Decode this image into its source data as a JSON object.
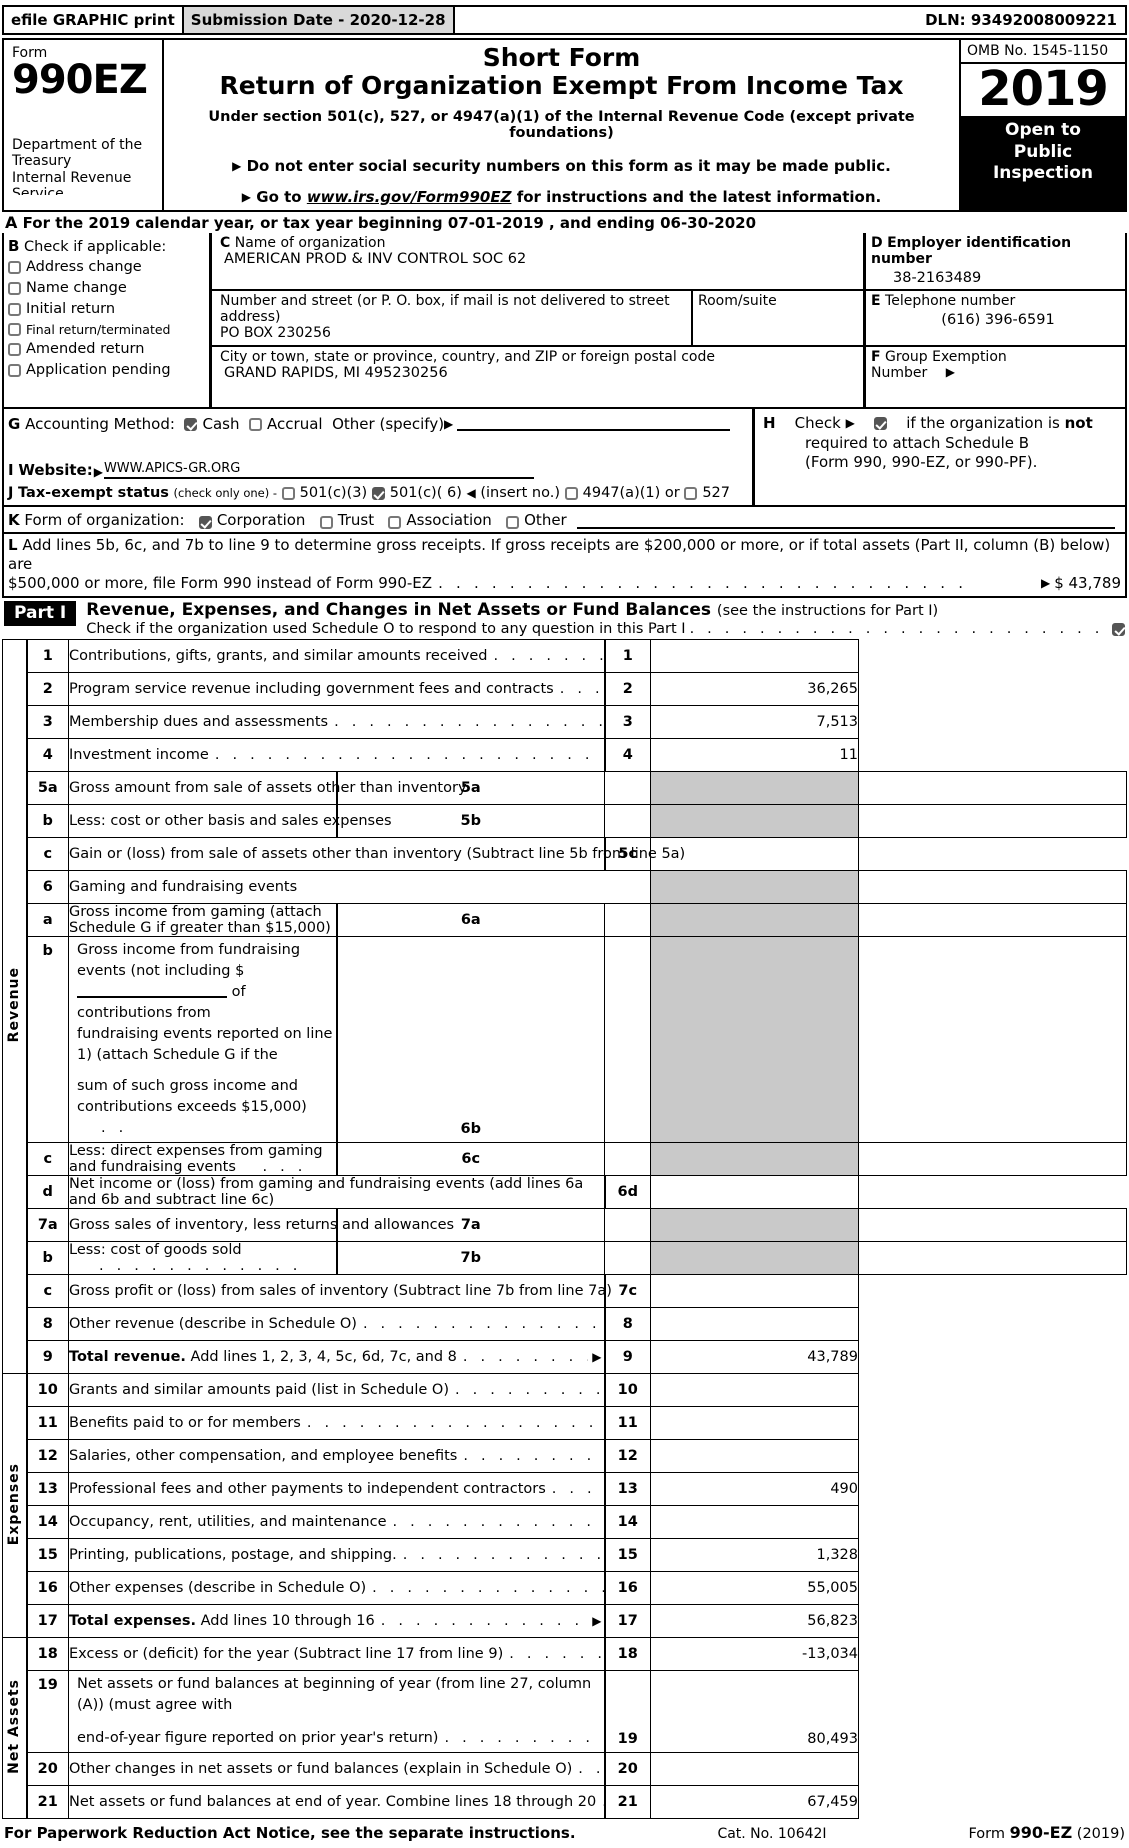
{
  "efile": {
    "graphic_label": "efile GRAPHIC print",
    "submission_label": "Submission Date - 2020-12-28",
    "dln": "DLN: 93492008009221"
  },
  "masthead": {
    "form_label": "Form",
    "form_number": "990EZ",
    "department_line1": "Department of the",
    "department_line2": "Treasury",
    "department_line3": "Internal Revenue",
    "department_line4": "Service",
    "title_line1": "Short Form",
    "title_line2": "Return of Organization Exempt From Income Tax",
    "subtitle": "Under section 501(c), 527, or 4947(a)(1) of the Internal Revenue Code (except private foundations)",
    "bullet1": "Do not enter social security numbers on this form as it may be made public.",
    "bullet2_prefix": "Go to",
    "bullet2_link": "www.irs.gov/Form990EZ",
    "bullet2_suffix": "for instructions and the latest information.",
    "omb": "OMB No. 1545-1150",
    "year": "2019",
    "open_line1": "Open to",
    "open_line2": "Public",
    "open_line3": "Inspection"
  },
  "line_a": {
    "letter": "A",
    "text_before": "For the 2019 calendar year, or tax year beginning",
    "begin_date": "07-01-2019",
    "text_middle": ", and ending",
    "end_date": "06-30-2020"
  },
  "section_b": {
    "letter": "B",
    "heading": "Check if applicable:",
    "items": [
      {
        "label": "Address change",
        "checked": false
      },
      {
        "label": "Name change",
        "checked": false
      },
      {
        "label": "Initial return",
        "checked": false
      },
      {
        "label": "Final return/terminated",
        "checked": false
      },
      {
        "label": "Amended return",
        "checked": false
      },
      {
        "label": "Application pending",
        "checked": false
      }
    ]
  },
  "section_c": {
    "letter": "C",
    "name_label": "Name of organization",
    "name_value": "AMERICAN PROD & INV CONTROL SOC 62",
    "street_label": "Number and street (or P. O. box, if mail is not delivered to street address)",
    "street_value": "PO BOX 230256",
    "room_label": "Room/suite",
    "room_value": "",
    "city_label": "City or town, state or province, country, and ZIP or foreign postal code",
    "city_value": "GRAND RAPIDS, MI   495230256"
  },
  "section_d": {
    "letter": "D",
    "label": "Employer identification number",
    "value": "38-2163489"
  },
  "section_e": {
    "letter": "E",
    "label": "Telephone number",
    "value": "(616) 396-6591"
  },
  "section_f": {
    "letter": "F",
    "label_line1": "Group Exemption",
    "label_line2": "Number",
    "value": ""
  },
  "section_g": {
    "letter": "G",
    "label": "Accounting Method:",
    "cash": "Cash",
    "cash_checked": true,
    "accrual": "Accrual",
    "accrual_checked": false,
    "other": "Other (specify)"
  },
  "section_h": {
    "letter": "H",
    "check_label": "Check",
    "checked": true,
    "text_line1_a": "if the organization is",
    "text_line1_b": "not",
    "text_line2": "required to attach Schedule B",
    "text_line3": "(Form 990, 990-EZ, or 990-PF)."
  },
  "section_i": {
    "letter": "I",
    "label": "Website:",
    "value": "WWW.APICS-GR.ORG"
  },
  "section_j": {
    "letter": "J",
    "label": "Tax-exempt status",
    "note": "(check only one) -",
    "opt1": "501(c)(3)",
    "opt1_checked": false,
    "opt2": "501(c)( 6)",
    "opt2_checked": true,
    "insert_note": "(insert no.)",
    "opt3": "4947(a)(1) or",
    "opt3_checked": false,
    "opt4": "527",
    "opt4_checked": false
  },
  "section_k": {
    "letter": "K",
    "label": "Form of organization:",
    "options": [
      {
        "label": "Corporation",
        "checked": true
      },
      {
        "label": "Trust",
        "checked": false
      },
      {
        "label": "Association",
        "checked": false
      },
      {
        "label": "Other",
        "checked": false
      }
    ]
  },
  "section_l": {
    "letter": "L",
    "line1": "Add lines 5b, 6c, and 7b to line 9 to determine gross receipts. If gross receipts are $200,000 or more, or if total assets (Part II, column (B) below) are",
    "line2": "$500,000 or more, file Form 990 instead of Form 990-EZ",
    "amount": "$ 43,789"
  },
  "part1": {
    "tag": "Part I",
    "title": "Revenue, Expenses, and Changes in Net Assets or Fund Balances",
    "title_note": "(see the instructions for Part I)",
    "schedule_o_text": "Check if the organization used Schedule O to respond to any question in this Part I",
    "schedule_o_checked": true,
    "side_label_revenue": "Revenue",
    "side_label_expenses": "Expenses",
    "side_label_net_assets": "Net Assets",
    "rows": [
      {
        "num": "1",
        "desc": "Contributions, gifts, grants, and similar amounts received",
        "lnum": "1",
        "amount": ""
      },
      {
        "num": "2",
        "desc": "Program service revenue including government fees and contracts",
        "lnum": "2",
        "amount": "36,265"
      },
      {
        "num": "3",
        "desc": "Membership dues and assessments",
        "lnum": "3",
        "amount": "7,513"
      },
      {
        "num": "4",
        "desc": "Investment income",
        "lnum": "4",
        "amount": "11"
      },
      {
        "num": "5a",
        "desc": "Gross amount from sale of assets other than inventory",
        "subnum": "5a",
        "subval": ""
      },
      {
        "num": "b",
        "desc": "Less: cost or other basis and sales expenses",
        "subnum": "5b",
        "subval": ""
      },
      {
        "num": "c",
        "desc": "Gain or (loss) from sale of assets other than inventory (Subtract line 5b from line 5a)",
        "lnum": "5c",
        "amount": ""
      },
      {
        "num": "6",
        "desc": "Gaming and fundraising events"
      },
      {
        "num": "a",
        "desc": "Gross income from gaming (attach Schedule G if greater than $15,000)",
        "subnum": "6a",
        "subval": ""
      },
      {
        "num": "b",
        "desc_l1_a": "Gross income from fundraising events (not including $",
        "desc_l1_b": "of contributions from",
        "desc_l2": "fundraising events reported on line 1) (attach Schedule G if the",
        "desc_l3": "sum of such gross income and contributions exceeds $15,000)",
        "subnum": "6b",
        "subval": ""
      },
      {
        "num": "c",
        "desc": "Less: direct expenses from gaming and fundraising events",
        "subnum": "6c",
        "subval": ""
      },
      {
        "num": "d",
        "desc": "Net income or (loss) from gaming and fundraising events (add lines 6a and 6b and subtract line 6c)",
        "lnum": "6d",
        "amount": ""
      },
      {
        "num": "7a",
        "desc": "Gross sales of inventory, less returns and allowances",
        "subnum": "7a",
        "subval": ""
      },
      {
        "num": "b",
        "desc": "Less: cost of goods sold",
        "subnum": "7b",
        "subval": ""
      },
      {
        "num": "c",
        "desc": "Gross profit or (loss) from sales of inventory (Subtract line 7b from line 7a)",
        "lnum": "7c",
        "amount": ""
      },
      {
        "num": "8",
        "desc": "Other revenue (describe in Schedule O)",
        "lnum": "8",
        "amount": ""
      },
      {
        "num": "9",
        "desc_bold": "Total revenue.",
        "desc": "Add lines 1, 2, 3, 4, 5c, 6d, 7c, and 8",
        "lnum": "9",
        "amount": "43,789"
      },
      {
        "num": "10",
        "desc": "Grants and similar amounts paid (list in Schedule O)",
        "lnum": "10",
        "amount": ""
      },
      {
        "num": "11",
        "desc": "Benefits paid to or for members",
        "lnum": "11",
        "amount": ""
      },
      {
        "num": "12",
        "desc": "Salaries, other compensation, and employee benefits",
        "lnum": "12",
        "amount": ""
      },
      {
        "num": "13",
        "desc": "Professional fees and other payments to independent contractors",
        "lnum": "13",
        "amount": "490"
      },
      {
        "num": "14",
        "desc": "Occupancy, rent, utilities, and maintenance",
        "lnum": "14",
        "amount": ""
      },
      {
        "num": "15",
        "desc": "Printing, publications, postage, and shipping.",
        "lnum": "15",
        "amount": "1,328"
      },
      {
        "num": "16",
        "desc": "Other expenses (describe in Schedule O)",
        "lnum": "16",
        "amount": "55,005"
      },
      {
        "num": "17",
        "desc_bold": "Total expenses.",
        "desc": "Add lines 10 through 16",
        "lnum": "17",
        "amount": "56,823"
      },
      {
        "num": "18",
        "desc": "Excess or (deficit) for the year (Subtract line 17 from line 9)",
        "lnum": "18",
        "amount": "-13,034"
      },
      {
        "num": "19",
        "desc_l1": "Net assets or fund balances at beginning of year (from line 27, column (A)) (must agree with",
        "desc_l2": "end-of-year figure reported on prior year's return)",
        "lnum": "19",
        "amount": "80,493"
      },
      {
        "num": "20",
        "desc": "Other changes in net assets or fund balances (explain in Schedule O)",
        "lnum": "20",
        "amount": ""
      },
      {
        "num": "21",
        "desc": "Net assets or fund balances at end of year. Combine lines 18 through 20",
        "lnum": "21",
        "amount": "67,459"
      }
    ]
  },
  "footer": {
    "notice": "For Paperwork Reduction Act Notice, see the separate instructions.",
    "cat_no": "Cat. No. 10642I",
    "form_prefix": "Form",
    "form_name": "990-EZ",
    "form_year": "(2019)"
  }
}
